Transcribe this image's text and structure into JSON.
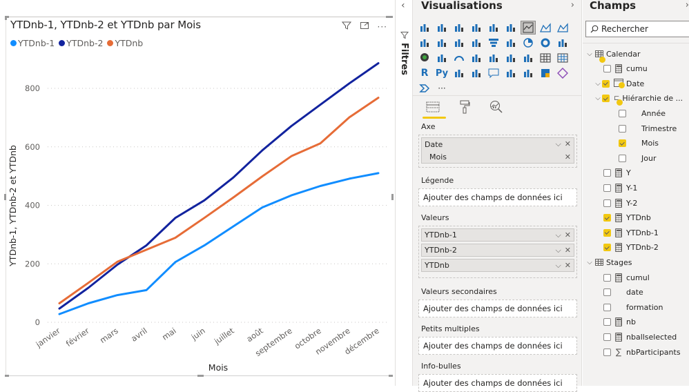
{
  "visual": {
    "title": "YTDnb-1, YTDnb-2 et YTDnb par Mois",
    "header_icons": [
      "filter-icon",
      "focus-mode-icon",
      "more-options-icon"
    ],
    "more_label": "···"
  },
  "chart_data": {
    "type": "line",
    "title": "YTDnb-1, YTDnb-2 et YTDnb par Mois",
    "xlabel": "Mois",
    "ylabel": "YTDnb-1, YTDnb-2 et YTDnb",
    "categories": [
      "janvier",
      "février",
      "mars",
      "avril",
      "mai",
      "juin",
      "juillet",
      "août",
      "septembre",
      "octobre",
      "novembre",
      "décembre"
    ],
    "ylim": [
      0,
      900
    ],
    "yticks": [
      0,
      200,
      400,
      600,
      800
    ],
    "ytick_labels": [
      "0",
      "200",
      "400",
      "600",
      "800"
    ],
    "grid": true,
    "legend_position": "top-left",
    "series": [
      {
        "name": "YTDnb-1",
        "color": "#118dff",
        "values": [
          28,
          65,
          93,
          110,
          206,
          263,
          328,
          393,
          434,
          466,
          491,
          510
        ]
      },
      {
        "name": "YTDnb-2",
        "color": "#12239e",
        "values": [
          47,
          118,
          197,
          263,
          357,
          417,
          495,
          588,
          671,
          744,
          817,
          886
        ]
      },
      {
        "name": "YTDnb",
        "color": "#e66c37",
        "values": [
          65,
          135,
          207,
          248,
          289,
          357,
          427,
          499,
          568,
          612,
          701,
          768
        ]
      }
    ]
  },
  "filters": {
    "label": "Filtres",
    "collapse_icon": "‹"
  },
  "visualizations": {
    "title": "Visualisations",
    "expand_icon": "›",
    "icons": [
      "stacked-bar-chart",
      "stacked-column-chart",
      "clustered-bar-chart",
      "clustered-column-chart",
      "100-stacked-bar-chart",
      "100-stacked-column-chart",
      "line-chart",
      "area-chart",
      "stacked-area-chart",
      "line-and-stacked-column-chart",
      "line-and-clustered-column-chart",
      "ribbon-chart",
      "waterfall-chart",
      "funnel-chart",
      "scatter-chart",
      "pie-chart",
      "donut-chart",
      "treemap",
      "map",
      "filled-map",
      "gauge",
      "card",
      "multi-row-card",
      "kpi",
      "slicer",
      "table",
      "matrix",
      "r-visual",
      "python-visual",
      "key-influencers",
      "decomposition-tree",
      "qa-visual",
      "smart-narrative",
      "paginated-report",
      "azure-map",
      "power-apps",
      "power-automate",
      "more-visuals"
    ],
    "selected_icon": "line-chart",
    "tabs": [
      "fields-tab",
      "format-tab",
      "analytics-tab"
    ],
    "wells": {
      "axe": {
        "label": "Axe",
        "fields": [
          {
            "name": "Date",
            "has_dropdown": true
          },
          {
            "name": "Mois",
            "has_dropdown": false
          }
        ]
      },
      "legende": {
        "label": "Légende",
        "placeholder": "Ajouter des champs de données ici"
      },
      "valeurs": {
        "label": "Valeurs",
        "fields": [
          {
            "name": "YTDnb-1"
          },
          {
            "name": "YTDnb-2"
          },
          {
            "name": "YTDnb"
          }
        ]
      },
      "valeurs_secondaires": {
        "label": "Valeurs secondaires",
        "placeholder": "Ajouter des champs de données ici"
      },
      "petits_multiples": {
        "label": "Petits multiples",
        "placeholder": "Ajouter des champs de données ici"
      },
      "info_bulles": {
        "label": "Info-bulles",
        "placeholder": "Ajouter des champs de données ici"
      }
    },
    "chevron_glyph": "⌵",
    "close_glyph": "✕"
  },
  "fields": {
    "title": "Champs",
    "expand_icon": "›",
    "search_placeholder": "Rechercher",
    "tree": [
      {
        "label": "Calendar",
        "type": "table",
        "level": 0,
        "expanded": true,
        "checked": null,
        "badge": true
      },
      {
        "label": "cumu",
        "type": "measure",
        "level": 1,
        "checked": false
      },
      {
        "label": "Date",
        "type": "date",
        "level": 1,
        "expanded": true,
        "checked": true,
        "badge": true
      },
      {
        "label": "Hiérarchie de ...",
        "type": "hierarchy",
        "level": 2,
        "expanded": true,
        "checked": true,
        "badge": true
      },
      {
        "label": "Année",
        "type": "none",
        "level": 3,
        "checked": false
      },
      {
        "label": "Trimestre",
        "type": "none",
        "level": 3,
        "checked": false
      },
      {
        "label": "Mois",
        "type": "none",
        "level": 3,
        "checked": true
      },
      {
        "label": "Jour",
        "type": "none",
        "level": 3,
        "checked": false
      },
      {
        "label": "Y",
        "type": "measure",
        "level": 1,
        "checked": false
      },
      {
        "label": "Y-1",
        "type": "measure",
        "level": 1,
        "checked": false
      },
      {
        "label": "Y-2",
        "type": "measure",
        "level": 1,
        "checked": false
      },
      {
        "label": "YTDnb",
        "type": "measure",
        "level": 1,
        "checked": true
      },
      {
        "label": "YTDnb-1",
        "type": "measure",
        "level": 1,
        "checked": true
      },
      {
        "label": "YTDnb-2",
        "type": "measure",
        "level": 1,
        "checked": true
      },
      {
        "label": "Stages",
        "type": "table",
        "level": 0,
        "expanded": true,
        "checked": null
      },
      {
        "label": "cumul",
        "type": "measure",
        "level": 1,
        "checked": false
      },
      {
        "label": "date",
        "type": "none",
        "level": 1,
        "checked": false
      },
      {
        "label": "formation",
        "type": "none",
        "level": 1,
        "checked": false
      },
      {
        "label": "nb",
        "type": "measure",
        "level": 1,
        "checked": false
      },
      {
        "label": "nballselected",
        "type": "measure",
        "level": 1,
        "checked": false
      },
      {
        "label": "nbParticipants",
        "type": "sum",
        "level": 1,
        "checked": false
      }
    ]
  }
}
